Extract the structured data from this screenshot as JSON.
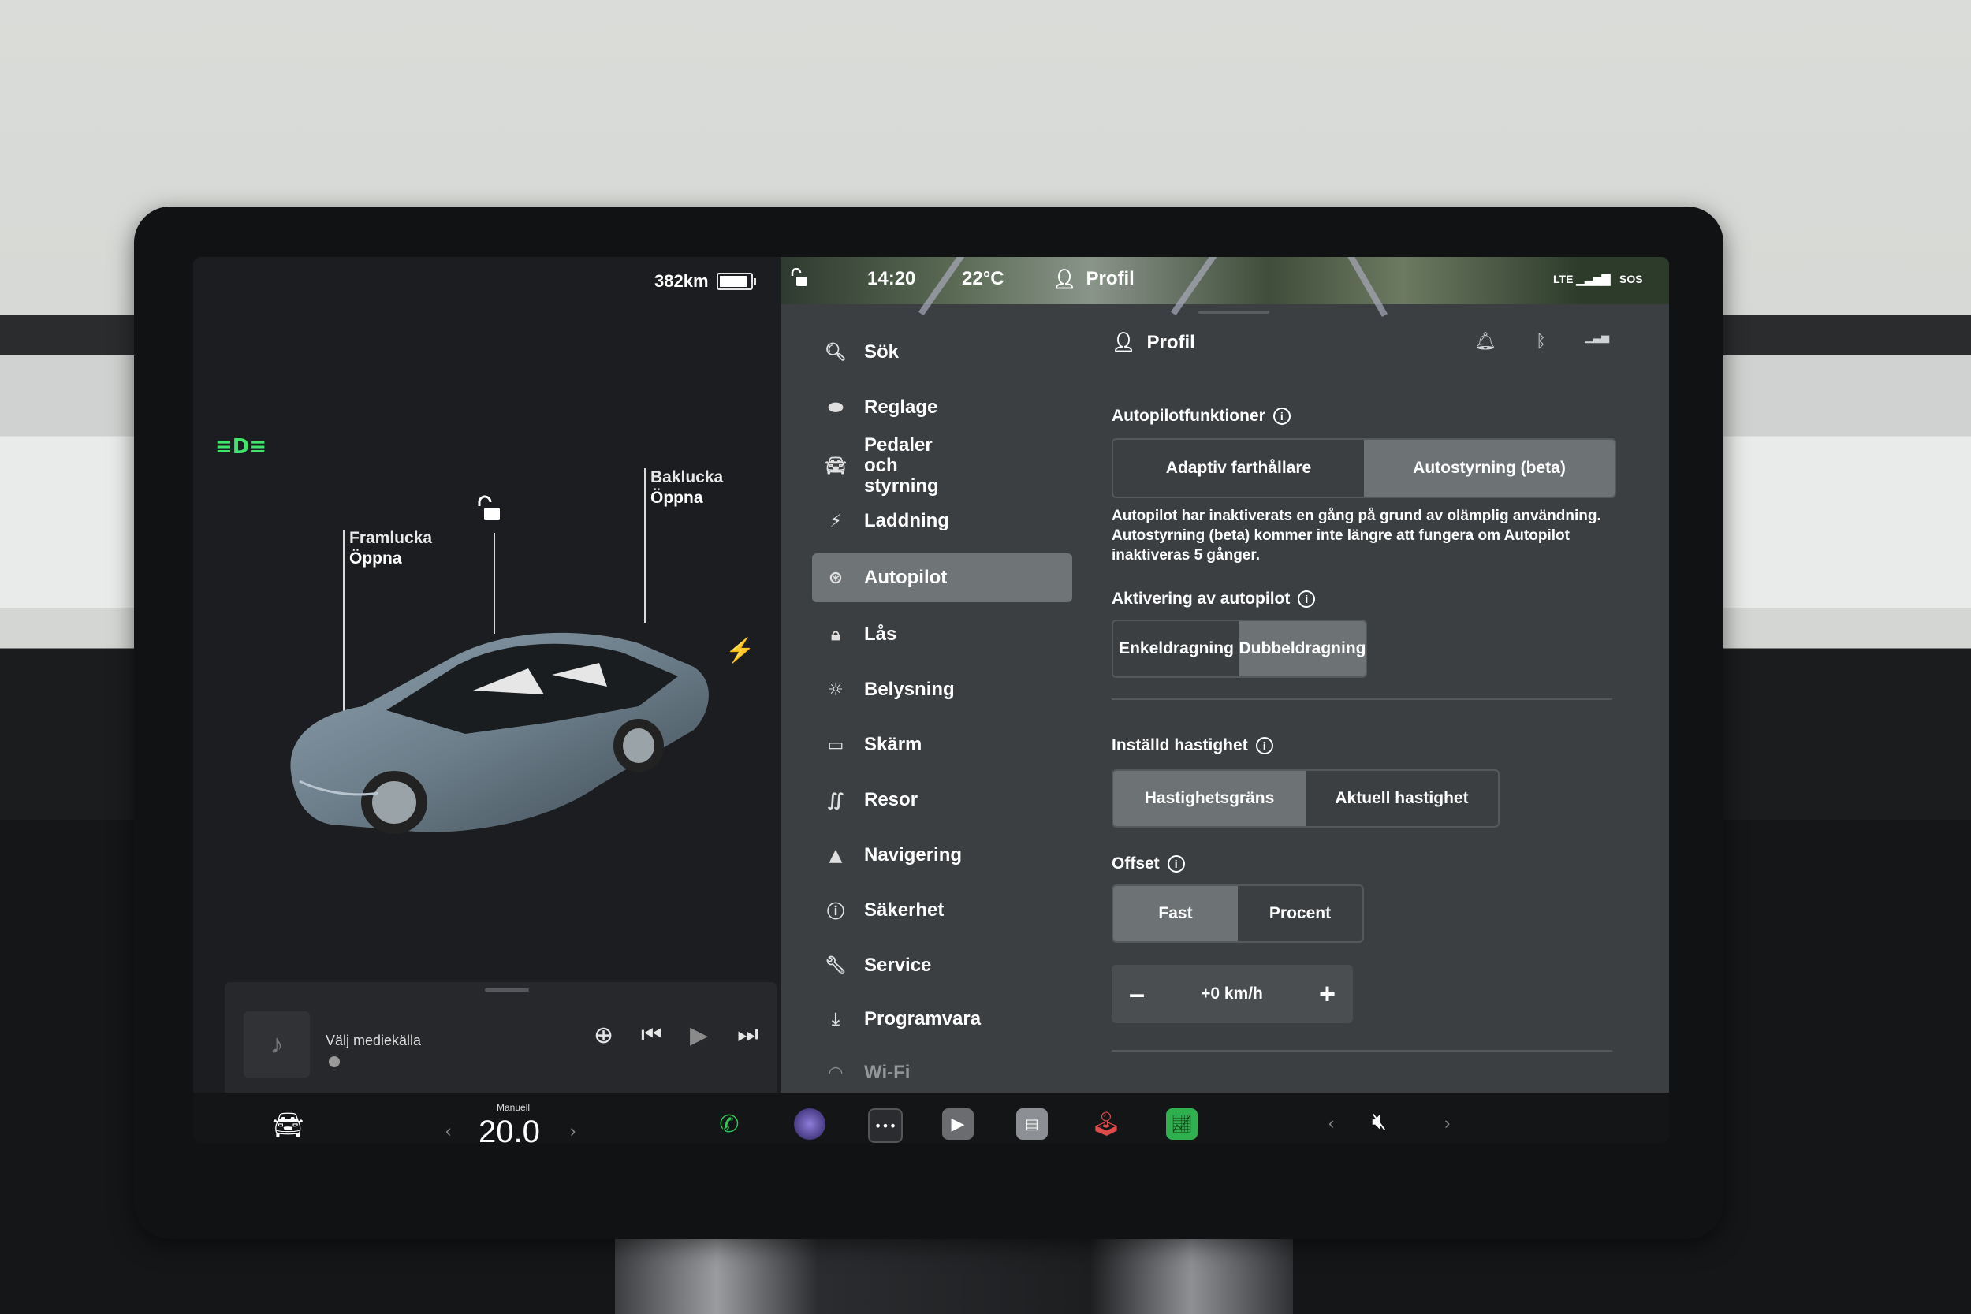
{
  "status_left": {
    "range": "382km",
    "battery_level": 0.92
  },
  "car_labels": {
    "front_trunk": {
      "title": "Framlucka",
      "action": "Öppna"
    },
    "rear_trunk": {
      "title": "Baklucka",
      "action": "Öppna"
    }
  },
  "media": {
    "source_label": "Välj mediekälla"
  },
  "top_status": {
    "time": "14:20",
    "temperature": "22°C",
    "profile": "Profil",
    "network": "LTE",
    "sos": "SOS"
  },
  "search": {
    "label": "Sök"
  },
  "nav_items": [
    {
      "label": "Reglage",
      "icon": "toggle-icon"
    },
    {
      "label": "Pedaler och styrning",
      "icon": "car-icon"
    },
    {
      "label": "Laddning",
      "icon": "bolt-icon"
    },
    {
      "label": "Autopilot",
      "icon": "steering-wheel-icon",
      "active": true
    },
    {
      "label": "Lås",
      "icon": "lock-icon"
    },
    {
      "label": "Belysning",
      "icon": "sun-icon"
    },
    {
      "label": "Skärm",
      "icon": "display-icon"
    },
    {
      "label": "Resor",
      "icon": "trips-icon"
    },
    {
      "label": "Navigering",
      "icon": "navigation-icon"
    },
    {
      "label": "Säkerhet",
      "icon": "safety-icon"
    },
    {
      "label": "Service",
      "icon": "wrench-icon"
    },
    {
      "label": "Programvara",
      "icon": "download-icon"
    },
    {
      "label": "Wi-Fi",
      "icon": "wifi-icon"
    }
  ],
  "panel": {
    "header": "Profil",
    "autopilot_features": {
      "title": "Autopilotfunktioner",
      "options": [
        "Adaptiv farthållare",
        "Autostyrning (beta)"
      ],
      "selected": 1,
      "notice": "Autopilot har inaktiverats en gång på grund av olämplig användning. Autostyrning (beta) kommer inte längre att fungera om Autopilot inaktiveras 5 gånger."
    },
    "activation": {
      "title": "Aktivering av autopilot",
      "options": [
        "Enkeldragning",
        "Dubbeldragning"
      ],
      "selected": 1
    },
    "set_speed": {
      "title": "Inställd hastighet",
      "options": [
        "Hastighetsgräns",
        "Aktuell hastighet"
      ],
      "selected": 0
    },
    "offset": {
      "title": "Offset",
      "options": [
        "Fast",
        "Procent"
      ],
      "selected": 0,
      "value": "+0 km/h",
      "minus": "–",
      "plus": "+"
    }
  },
  "climate": {
    "mode": "Manuell",
    "temp": "20.0"
  },
  "accent_colors": {
    "headlight": "#3ee66b",
    "phone": "#35c759",
    "active_nav": "#6f7477"
  }
}
